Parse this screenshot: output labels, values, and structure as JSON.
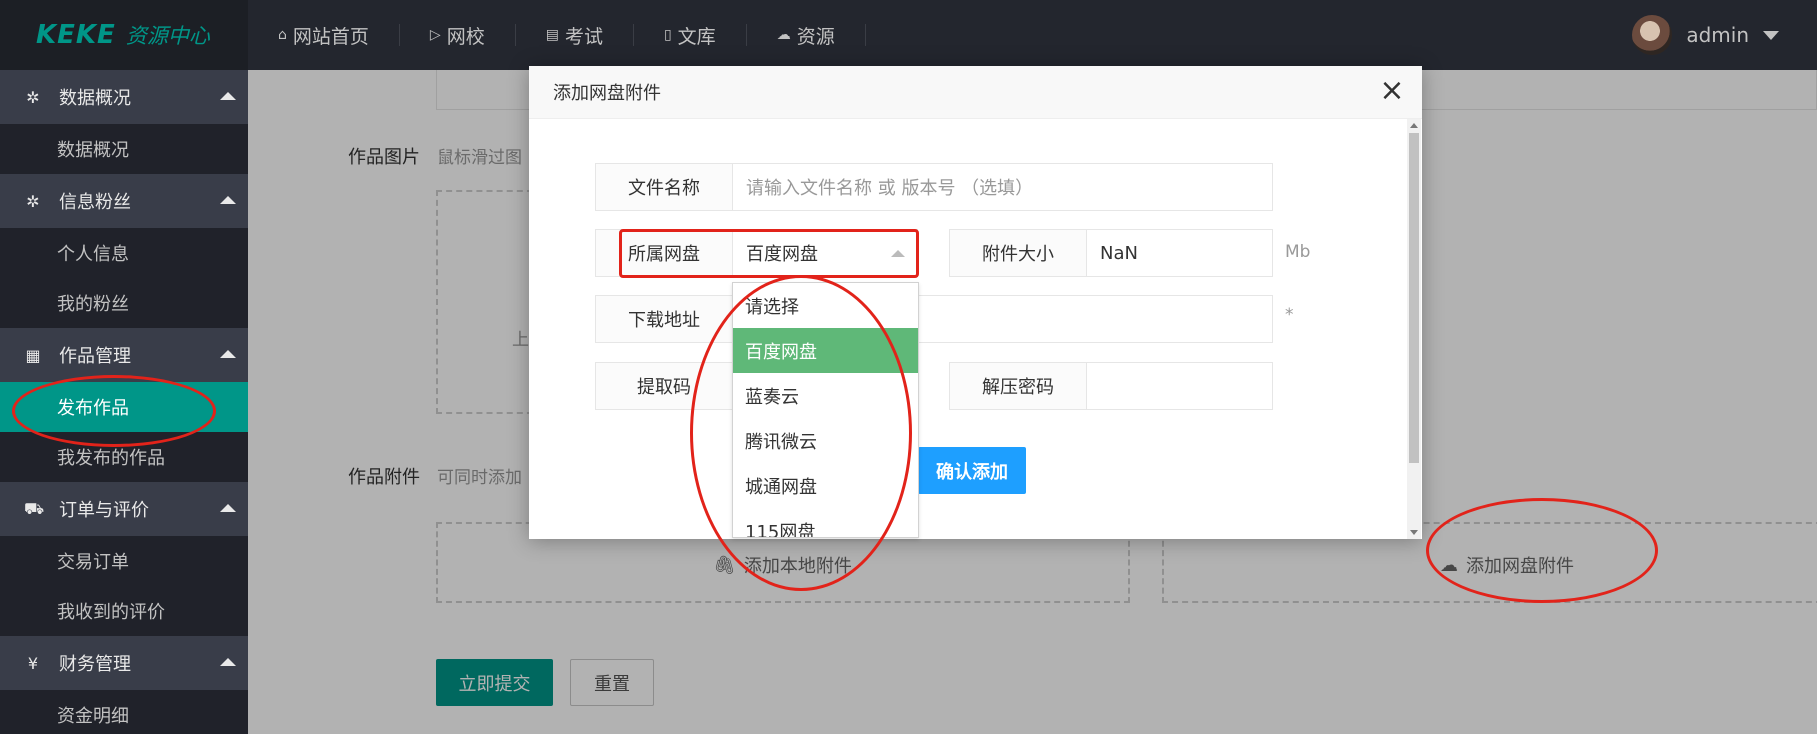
{
  "header": {
    "brand": "KEKE",
    "brand_sub": "资源中心",
    "nav": [
      {
        "icon": "home-icon",
        "glyph": "⌂",
        "label": "网站首页"
      },
      {
        "icon": "play-icon",
        "glyph": "▷",
        "label": "网校"
      },
      {
        "icon": "exam-icon",
        "glyph": "▤",
        "label": "考试"
      },
      {
        "icon": "document-icon",
        "glyph": "▯",
        "label": "文库"
      },
      {
        "icon": "cloud-upload-icon",
        "glyph": "☁",
        "label": "资源"
      }
    ],
    "username": "admin"
  },
  "sidebar": {
    "groups": [
      {
        "label": "数据概况",
        "icon": "gear-icon",
        "items": [
          "数据概况"
        ]
      },
      {
        "label": "信息粉丝",
        "icon": "gear-icon",
        "items": [
          "个人信息",
          "我的粉丝"
        ]
      },
      {
        "label": "作品管理",
        "icon": "grid-icon",
        "items": [
          "发布作品",
          "我发布的作品"
        ]
      },
      {
        "label": "订单与评价",
        "icon": "cart-icon",
        "items": [
          "交易订单",
          "我收到的评价"
        ]
      },
      {
        "label": "财务管理",
        "icon": "yen-icon",
        "items": [
          "资金明细"
        ]
      }
    ],
    "active_item": "发布作品"
  },
  "page": {
    "image_label": "作品图片",
    "image_hint": "鼠标滑过图",
    "upload_partial": "上",
    "attach_label": "作品附件",
    "attach_hint": "可同时添加",
    "add_local": "添加本地附件",
    "add_netdisk": "添加网盘附件",
    "submit": "立即提交",
    "reset": "重置"
  },
  "modal": {
    "title": "添加网盘附件",
    "filename_label": "文件名称",
    "filename_placeholder": "请输入文件名称 或 版本号 （选填）",
    "netdisk_label": "所属网盘",
    "netdisk_value": "百度网盘",
    "size_label": "附件大小",
    "size_value": "NaN",
    "size_unit": "Mb",
    "url_label": "下载地址",
    "url_required": "*",
    "code_label": "提取码",
    "unzip_label": "解压密码",
    "confirm": "确认添加",
    "options": [
      "请选择",
      "百度网盘",
      "蓝奏云",
      "腾讯微云",
      "城通网盘",
      "115网盘"
    ],
    "selected_option": "百度网盘"
  }
}
